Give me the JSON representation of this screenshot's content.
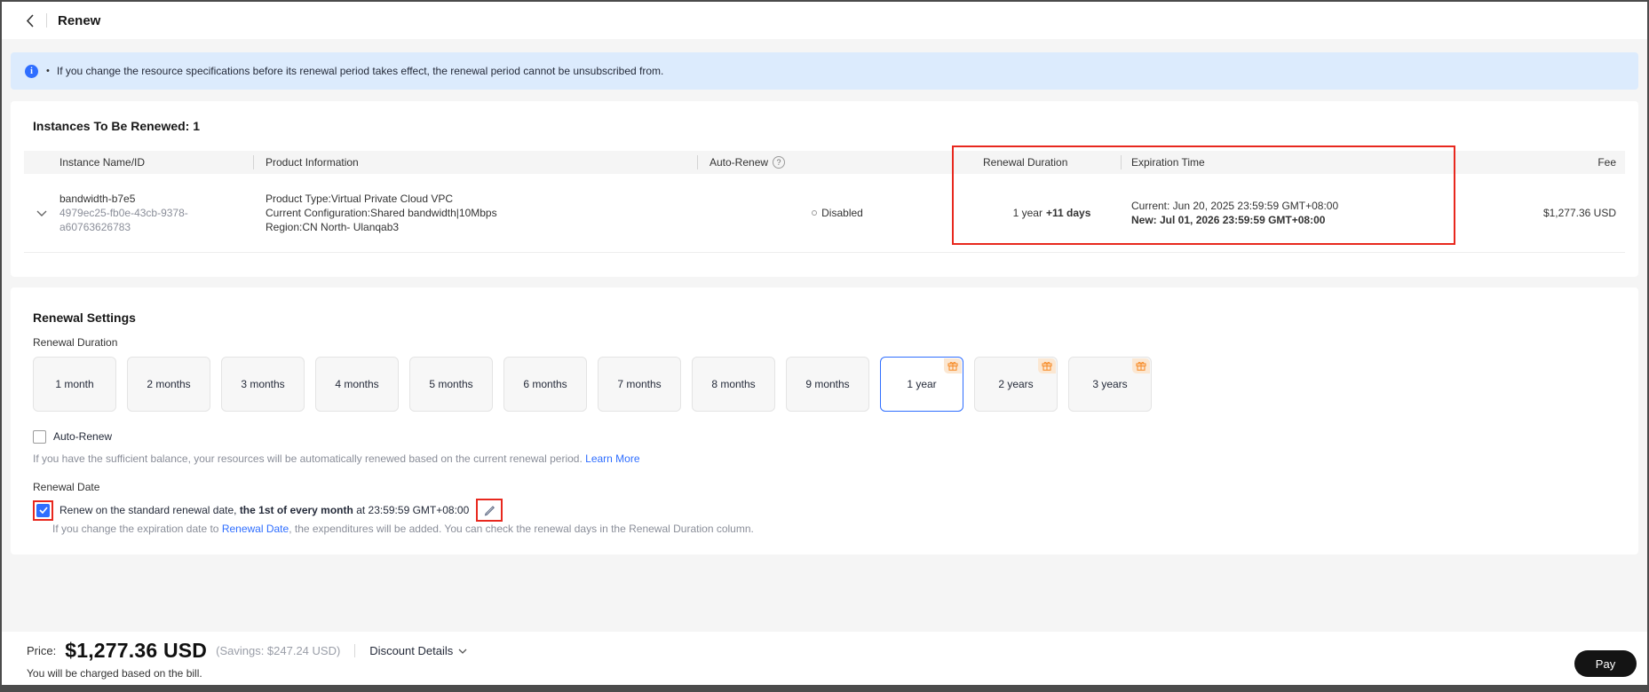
{
  "header": {
    "title": "Renew"
  },
  "banner": {
    "bullet": "•",
    "text": "If you change the resource specifications before its renewal period takes effect, the renewal period cannot be unsubscribed from."
  },
  "instances": {
    "title": "Instances To Be Renewed: 1",
    "columns": [
      "Instance Name/ID",
      "Product Information",
      "Auto-Renew",
      "Renewal Duration",
      "Expiration Time",
      "Fee"
    ],
    "help_icon": "?",
    "row": {
      "name": "bandwidth-b7e5",
      "id": "4979ec25-fb0e-43cb-9378-a60763626783",
      "product_type": "Product Type:Virtual Private Cloud VPC",
      "current_configuration": "Current Configuration:Shared bandwidth|10Mbps",
      "region": "Region:CN North- Ulanqab3",
      "auto_renew": "Disabled",
      "renewal_duration": "1 year",
      "renewal_duration_extra": "+11 days",
      "expiration_current": "Current: Jun 20, 2025 23:59:59 GMT+08:00",
      "expiration_new": "New: Jul 01, 2026 23:59:59 GMT+08:00",
      "fee": "$1,277.36 USD"
    }
  },
  "renewal_settings": {
    "title": "Renewal Settings",
    "duration_label": "Renewal Duration",
    "durations": [
      "1 month",
      "2 months",
      "3 months",
      "4 months",
      "5 months",
      "6 months",
      "7 months",
      "8 months",
      "9 months",
      "1 year",
      "2 years",
      "3 years"
    ],
    "selected_duration": "1 year",
    "auto_renew_label": "Auto-Renew",
    "auto_renew_hint": "If you have the sufficient balance, your resources will be automatically renewed based on the current renewal period.",
    "learn_more": "Learn More",
    "renewal_date_label": "Renewal Date",
    "renewal_date_prefix": "Renew on the standard renewal date,",
    "renewal_date_bold": "the 1st of every month",
    "renewal_date_suffix": "at 23:59:59 GMT+08:00",
    "renewal_date_hint_prefix": "If you change the expiration date to",
    "renewal_date_link": "Renewal Date",
    "renewal_date_hint_suffix": ", the expenditures will be added. You can check the renewal days in the Renewal Duration column."
  },
  "footer": {
    "price_label": "Price:",
    "price": "$1,277.36 USD",
    "savings": "(Savings: $247.24 USD)",
    "discount_details": "Discount Details",
    "note": "You will be charged based on the bill.",
    "pay": "Pay"
  },
  "colors": {
    "accent_blue": "#2f6eff",
    "highlight_red": "#e8281e",
    "banner_bg": "#dcebfd",
    "gift_orange": "#f78f2e",
    "pay_button_bg": "#141414"
  }
}
